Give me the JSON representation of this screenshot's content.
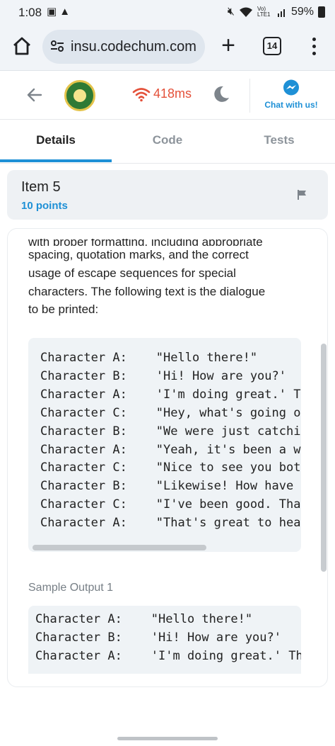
{
  "status_bar": {
    "time": "1:08",
    "left_icons": [
      "image-icon",
      "warning-icon"
    ],
    "right_icons": [
      "mute-icon",
      "wifi-icon",
      "signal-icon"
    ],
    "network_label": "Vo) LTE1",
    "battery": "59%"
  },
  "browser": {
    "url": "insu.codechum.com",
    "tab_count": "14"
  },
  "app_header": {
    "latency": "418ms",
    "chat_label": "Chat with us!",
    "colors": {
      "latency": "#e4513a",
      "accent": "#1e90d6"
    }
  },
  "tabs": [
    {
      "label": "Details",
      "active": true
    },
    {
      "label": "Code",
      "active": false
    },
    {
      "label": "Tests",
      "active": false
    }
  ],
  "item": {
    "title": "Item 5",
    "points": "10 points"
  },
  "description": {
    "cut_line": "with proper formatting, including appropriate",
    "lines": [
      "spacing, quotation marks, and the correct",
      "usage of escape sequences for special",
      "characters. The following text is the dialogue",
      "to be printed:"
    ]
  },
  "dialogue": [
    {
      "speaker": "Character A:",
      "line": "\"Hello there!\""
    },
    {
      "speaker": "Character B:",
      "line": "'Hi! How are you?'"
    },
    {
      "speaker": "Character A:",
      "line": "'I'm doing great.' T"
    },
    {
      "speaker": "Character C:",
      "line": "\"Hey, what's going o"
    },
    {
      "speaker": "Character B:",
      "line": "\"We were just catchi"
    },
    {
      "speaker": "Character A:",
      "line": "\"Yeah, it's been a w"
    },
    {
      "speaker": "Character C:",
      "line": "\"Nice to see you bot"
    },
    {
      "speaker": "Character B:",
      "line": "\"Likewise! How have"
    },
    {
      "speaker": "Character C:",
      "line": "\"I've been good. Tha"
    },
    {
      "speaker": "Character A:",
      "line": "\"That's great to hea"
    }
  ],
  "sample_output": {
    "label": "Sample Output 1",
    "lines": [
      {
        "speaker": "Character A:",
        "line": "\"Hello there!\""
      },
      {
        "speaker": "Character B:",
        "line": "'Hi! How are you?'"
      },
      {
        "speaker": "Character A:",
        "line": "'I'm doing great.' Th"
      }
    ]
  }
}
